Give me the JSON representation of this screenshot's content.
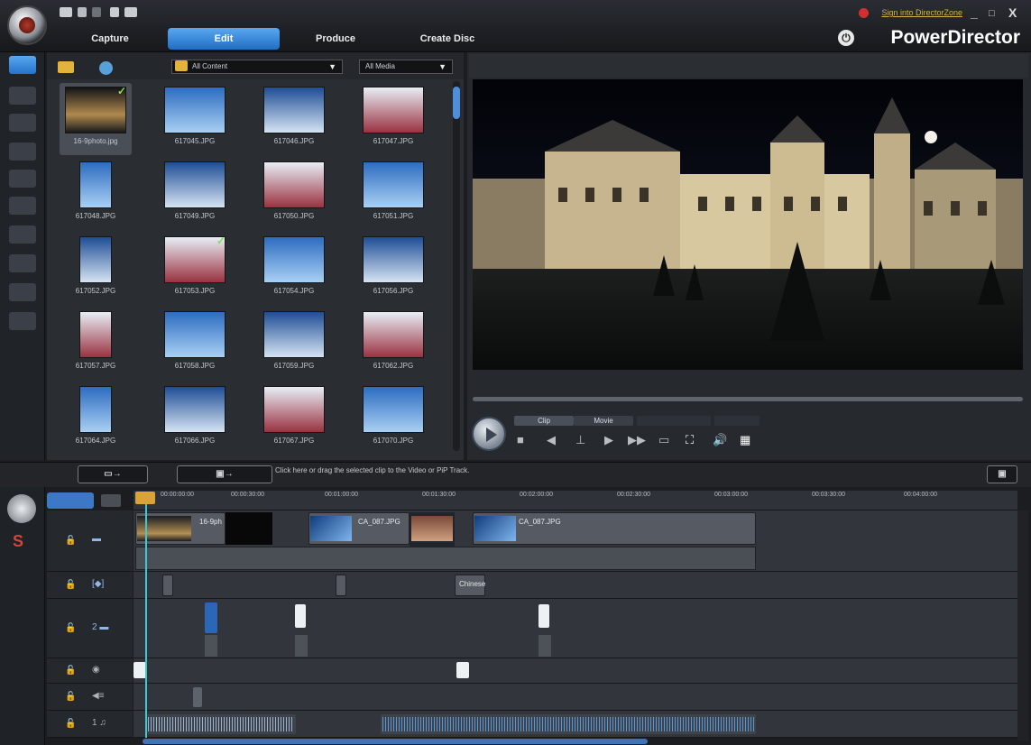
{
  "app": {
    "brand": "PowerDirector",
    "signin": "Sign into DirectorZone",
    "window_controls": [
      "_",
      "□",
      "X"
    ]
  },
  "tabs": [
    {
      "label": "Capture",
      "active": false
    },
    {
      "label": "Edit",
      "active": true
    },
    {
      "label": "Produce",
      "active": false
    },
    {
      "label": "Create Disc",
      "active": false
    }
  ],
  "library": {
    "content_filter": "All Content",
    "media_filter": "All Media",
    "items": [
      {
        "name": "16-9photo.jpg",
        "selected": true,
        "checked": true
      },
      {
        "name": "617045.JPG"
      },
      {
        "name": "617046.JPG"
      },
      {
        "name": "617047.JPG"
      },
      {
        "name": "617048.JPG"
      },
      {
        "name": "617049.JPG"
      },
      {
        "name": "617050.JPG"
      },
      {
        "name": "617051.JPG"
      },
      {
        "name": "617052.JPG"
      },
      {
        "name": "617053.JPG",
        "checked": true
      },
      {
        "name": "617054.JPG"
      },
      {
        "name": "617056.JPG"
      },
      {
        "name": "617057.JPG"
      },
      {
        "name": "617058.JPG"
      },
      {
        "name": "617059.JPG"
      },
      {
        "name": "617062.JPG"
      },
      {
        "name": "617064.JPG"
      },
      {
        "name": "617066.JPG"
      },
      {
        "name": "617067.JPG"
      },
      {
        "name": "617070.JPG"
      }
    ]
  },
  "preview": {
    "mode_clip": "Clip",
    "mode_movie": "Movie"
  },
  "timeline": {
    "hint": "Click here or drag the selected clip to the Video or PiP Track.",
    "ticks": [
      "00:00:00:00",
      "00:00:30:00",
      "00:01:00:00",
      "00:01:30:00",
      "00:02:00:00",
      "00:02:30:00",
      "00:03:00:00",
      "00:03:30:00",
      "00:04:00:00"
    ],
    "clips": {
      "video1": "16-9ph",
      "video2": "CA_087.JPG",
      "video3": "CA_087.JPG",
      "fx_chinese": "Chinese"
    }
  }
}
